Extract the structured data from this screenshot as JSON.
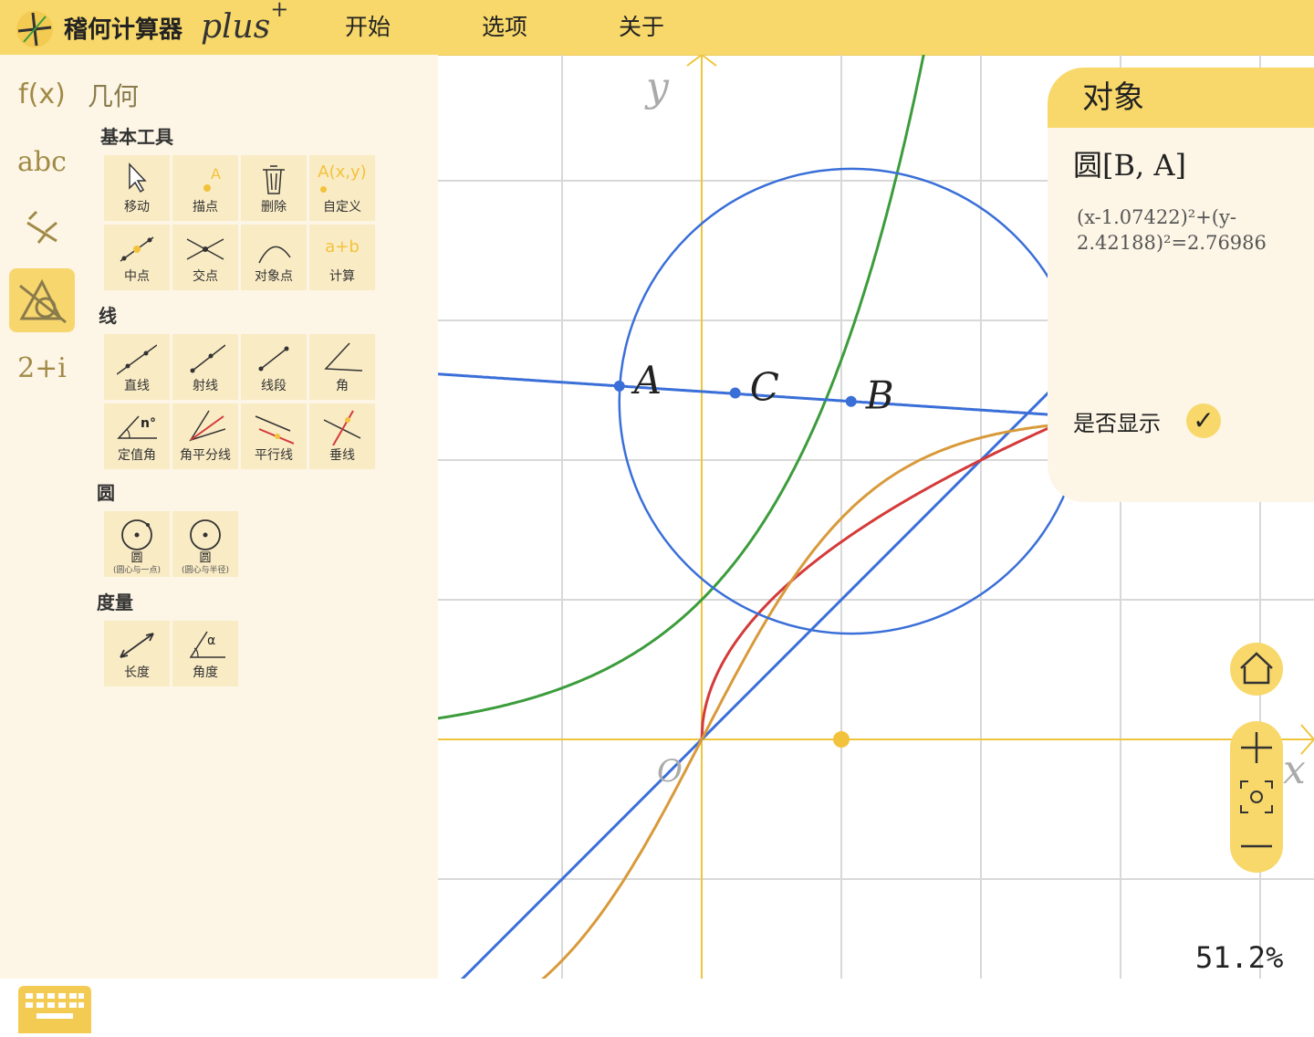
{
  "app": {
    "name": "稽何计算器",
    "name_suffix": "plus",
    "name_mark": "+"
  },
  "menu": {
    "start": "开始",
    "options": "选项",
    "about": "关于"
  },
  "categories": {
    "function": "f(x)",
    "text": "abc",
    "fraction": "⁵⁄₅",
    "complex": "2+i"
  },
  "mode_label": "几何",
  "sections": {
    "basic": "基本工具",
    "line": "线",
    "circle": "圆",
    "measure": "度量"
  },
  "tools": {
    "move": "移动",
    "point": "描点",
    "delete": "删除",
    "custom": "自定义",
    "custom_icon": "A(x,y)",
    "midpoint": "中点",
    "intersection": "交点",
    "object_point": "对象点",
    "calculate": "计算",
    "calculate_icon": "a+b",
    "line": "直线",
    "ray": "射线",
    "segment": "线段",
    "angle": "角",
    "fixed_angle": "定值角",
    "fixed_angle_icon": "n°",
    "bisector": "角平分线",
    "parallel": "平行线",
    "perpendicular": "垂线",
    "circle_center_point": "圆",
    "circle_center_point_sub": "(圆心与一点)",
    "circle_center_radius": "圆",
    "circle_center_radius_sub": "(圆心与半径)",
    "length": "长度",
    "angle_measure": "角度",
    "angle_measure_icon": "α"
  },
  "panel": {
    "title": "对象",
    "object_name": "圆[B, A]",
    "equation": "(x-1.07422)²+(y-2.42188)²=2.76986",
    "show_label": "是否显示",
    "show_checked": "✓"
  },
  "canvas": {
    "x_axis_label": "x",
    "y_axis_label": "y",
    "origin_label": "O",
    "zoom": "51.2%",
    "points": [
      {
        "label": "A",
        "x": -0.59,
        "y": 2.53
      },
      {
        "label": "C",
        "x": 0.24,
        "y": 2.48
      },
      {
        "label": "B",
        "x": 1.07,
        "y": 2.42
      }
    ],
    "colors": {
      "accent": "#f8d86a",
      "circle": "#3a6fd8",
      "green": "#3c9c3c",
      "red": "#d43a3a",
      "orange": "#d89a3a",
      "axis": "#efc53c"
    }
  }
}
